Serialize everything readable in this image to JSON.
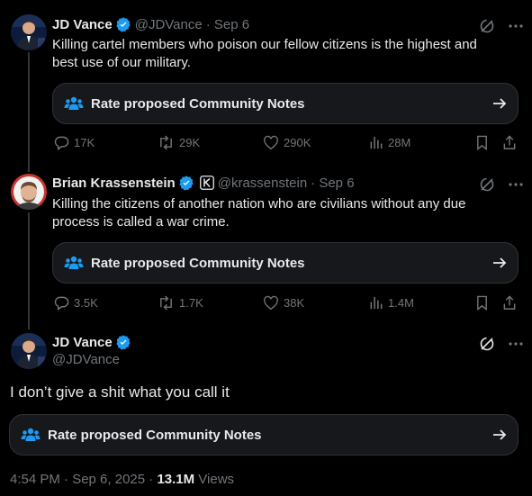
{
  "colors": {
    "accent": "#1d9bf0",
    "muted": "#71767b",
    "text": "#e7e9ea",
    "card": "#16181c",
    "border": "#2f3336"
  },
  "posts": [
    {
      "name": "JD Vance",
      "handle": "@JDVance",
      "date": "· Sep 6",
      "text": "Killing cartel members who poison our fellow citizens is the highest and best use of our military.",
      "community_note_label": "Rate proposed Community Notes",
      "stats": {
        "replies": "17K",
        "reposts": "29K",
        "likes": "290K",
        "views": "28M"
      }
    },
    {
      "name": "Brian Krassenstein",
      "handle": "@krassenstein",
      "date": "· Sep 6",
      "text": "Killing the citizens of another nation who are civilians without any due process is called a war crime.",
      "community_note_label": "Rate proposed Community Notes",
      "stats": {
        "replies": "3.5K",
        "reposts": "1.7K",
        "likes": "38K",
        "views": "1.4M"
      }
    }
  ],
  "main_post": {
    "name": "JD Vance",
    "handle": "@JDVance",
    "text": "I don’t give a shit what you call it",
    "community_note_label": "Rate proposed Community Notes",
    "timestamp": "4:54 PM · Sep 6, 2025 · ",
    "views_count": "13.1M",
    "views_label": " Views"
  },
  "icons": {
    "verified": "verified-badge-icon",
    "affiliate": "affiliate-k-icon",
    "grok": "grok-icon",
    "more": "more-icon",
    "community_notes": "community-notes-people-icon",
    "arrow": "arrow-right-icon",
    "reply": "reply-icon",
    "repost": "repost-icon",
    "like": "heart-icon",
    "views": "views-icon",
    "bookmark": "bookmark-icon",
    "share": "share-icon"
  }
}
